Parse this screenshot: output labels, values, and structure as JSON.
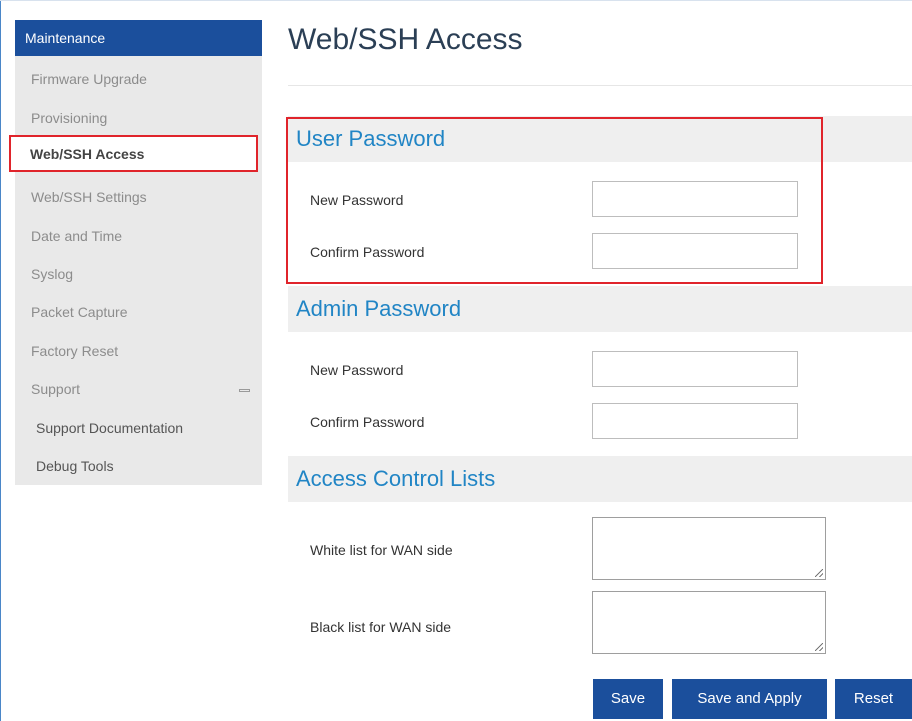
{
  "sidebar": {
    "header": "Maintenance",
    "items": [
      {
        "label": "Firmware Upgrade"
      },
      {
        "label": "Provisioning"
      },
      {
        "label": "Web/SSH Access"
      },
      {
        "label": "Web/SSH Settings"
      },
      {
        "label": "Date and Time"
      },
      {
        "label": "Syslog"
      },
      {
        "label": "Packet Capture"
      },
      {
        "label": "Factory Reset"
      },
      {
        "label": "Support"
      }
    ],
    "subitems": [
      {
        "label": "Support Documentation"
      },
      {
        "label": "Debug Tools"
      }
    ],
    "active_item": "Web/SSH Access"
  },
  "page": {
    "title": "Web/SSH Access"
  },
  "sections": {
    "user_password": {
      "title": "User Password",
      "new_label": "New Password",
      "confirm_label": "Confirm Password",
      "new_value": "",
      "confirm_value": ""
    },
    "admin_password": {
      "title": "Admin Password",
      "new_label": "New Password",
      "confirm_label": "Confirm Password",
      "new_value": "",
      "confirm_value": ""
    },
    "acl": {
      "title": "Access Control Lists",
      "white_label": "White list for WAN side",
      "black_label": "Black list for WAN side",
      "white_value": "",
      "black_value": ""
    }
  },
  "buttons": {
    "save": "Save",
    "save_apply": "Save and Apply",
    "reset": "Reset"
  },
  "colors": {
    "nav_header": "#1b4f9c",
    "section_title": "#2185c5",
    "highlight": "#e0242b",
    "button": "#1b4f9c"
  }
}
